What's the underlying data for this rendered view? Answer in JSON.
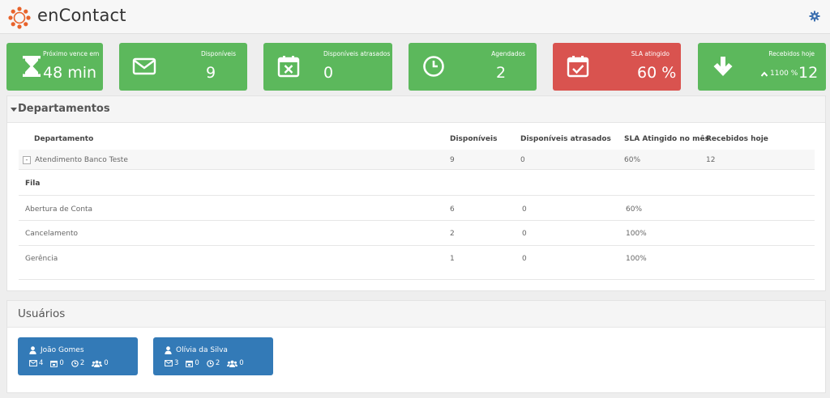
{
  "brand": "enContact",
  "tiles": [
    {
      "label": "Próximo vence em",
      "value": "48 min",
      "icon": "hourglass-icon"
    },
    {
      "label": "Disponíveis",
      "value": "9",
      "icon": "envelope-icon"
    },
    {
      "label": "Disponíveis atrasados",
      "value": "0",
      "icon": "calendar-x-icon"
    },
    {
      "label": "Agendados",
      "value": "2",
      "icon": "clock-icon"
    },
    {
      "label": "SLA atingido",
      "value": "60 %",
      "icon": "calendar-check-icon"
    },
    {
      "label": "Recebidos hoje",
      "value": "12",
      "trend": "1100 %",
      "icon": "arrow-down-icon"
    }
  ],
  "colors": {
    "green": "#5cb85c",
    "red": "#d9534f",
    "blue": "#337ab7"
  },
  "departments": {
    "title": "Departamentos",
    "headers": [
      "Departamento",
      "Disponíveis",
      "Disponíveis atrasados",
      "SLA Atingido no mês",
      "Recebidos hoje"
    ],
    "dept_row": {
      "name": "Atendimento Banco Teste",
      "disponiveis": "9",
      "atrasados": "0",
      "sla": "60%",
      "recebidos": "12",
      "expander": "-"
    },
    "queue_header": "Fila",
    "queues": [
      {
        "name": "Abertura de Conta",
        "disponiveis": "6",
        "atrasados": "0",
        "sla": "60%"
      },
      {
        "name": "Cancelamento",
        "disponiveis": "2",
        "atrasados": "0",
        "sla": "100%"
      },
      {
        "name": "Gerência",
        "disponiveis": "1",
        "atrasados": "0",
        "sla": "100%"
      }
    ]
  },
  "users": {
    "title": "Usuários",
    "list": [
      {
        "name": "João Gomes",
        "messages": "4",
        "calendar": "0",
        "clock": "2",
        "groups": "0"
      },
      {
        "name": "Olívia da Silva",
        "messages": "3",
        "calendar": "0",
        "clock": "2",
        "groups": "0"
      }
    ]
  }
}
